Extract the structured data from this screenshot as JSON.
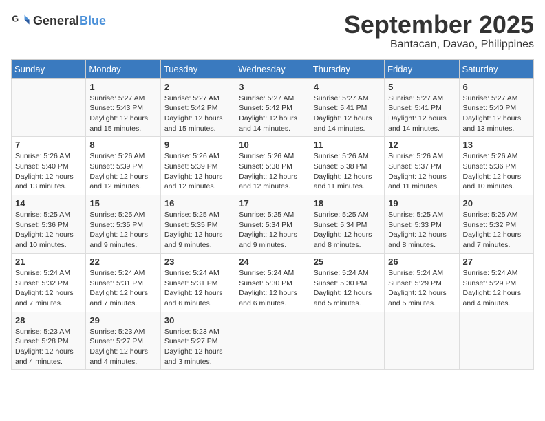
{
  "header": {
    "logo_general": "General",
    "logo_blue": "Blue",
    "month_title": "September 2025",
    "location": "Bantacan, Davao, Philippines"
  },
  "days_of_week": [
    "Sunday",
    "Monday",
    "Tuesday",
    "Wednesday",
    "Thursday",
    "Friday",
    "Saturday"
  ],
  "weeks": [
    [
      {
        "day": "",
        "info": ""
      },
      {
        "day": "1",
        "info": "Sunrise: 5:27 AM\nSunset: 5:43 PM\nDaylight: 12 hours\nand 15 minutes."
      },
      {
        "day": "2",
        "info": "Sunrise: 5:27 AM\nSunset: 5:42 PM\nDaylight: 12 hours\nand 15 minutes."
      },
      {
        "day": "3",
        "info": "Sunrise: 5:27 AM\nSunset: 5:42 PM\nDaylight: 12 hours\nand 14 minutes."
      },
      {
        "day": "4",
        "info": "Sunrise: 5:27 AM\nSunset: 5:41 PM\nDaylight: 12 hours\nand 14 minutes."
      },
      {
        "day": "5",
        "info": "Sunrise: 5:27 AM\nSunset: 5:41 PM\nDaylight: 12 hours\nand 14 minutes."
      },
      {
        "day": "6",
        "info": "Sunrise: 5:27 AM\nSunset: 5:40 PM\nDaylight: 12 hours\nand 13 minutes."
      }
    ],
    [
      {
        "day": "7",
        "info": "Sunrise: 5:26 AM\nSunset: 5:40 PM\nDaylight: 12 hours\nand 13 minutes."
      },
      {
        "day": "8",
        "info": "Sunrise: 5:26 AM\nSunset: 5:39 PM\nDaylight: 12 hours\nand 12 minutes."
      },
      {
        "day": "9",
        "info": "Sunrise: 5:26 AM\nSunset: 5:39 PM\nDaylight: 12 hours\nand 12 minutes."
      },
      {
        "day": "10",
        "info": "Sunrise: 5:26 AM\nSunset: 5:38 PM\nDaylight: 12 hours\nand 12 minutes."
      },
      {
        "day": "11",
        "info": "Sunrise: 5:26 AM\nSunset: 5:38 PM\nDaylight: 12 hours\nand 11 minutes."
      },
      {
        "day": "12",
        "info": "Sunrise: 5:26 AM\nSunset: 5:37 PM\nDaylight: 12 hours\nand 11 minutes."
      },
      {
        "day": "13",
        "info": "Sunrise: 5:26 AM\nSunset: 5:36 PM\nDaylight: 12 hours\nand 10 minutes."
      }
    ],
    [
      {
        "day": "14",
        "info": "Sunrise: 5:25 AM\nSunset: 5:36 PM\nDaylight: 12 hours\nand 10 minutes."
      },
      {
        "day": "15",
        "info": "Sunrise: 5:25 AM\nSunset: 5:35 PM\nDaylight: 12 hours\nand 9 minutes."
      },
      {
        "day": "16",
        "info": "Sunrise: 5:25 AM\nSunset: 5:35 PM\nDaylight: 12 hours\nand 9 minutes."
      },
      {
        "day": "17",
        "info": "Sunrise: 5:25 AM\nSunset: 5:34 PM\nDaylight: 12 hours\nand 9 minutes."
      },
      {
        "day": "18",
        "info": "Sunrise: 5:25 AM\nSunset: 5:34 PM\nDaylight: 12 hours\nand 8 minutes."
      },
      {
        "day": "19",
        "info": "Sunrise: 5:25 AM\nSunset: 5:33 PM\nDaylight: 12 hours\nand 8 minutes."
      },
      {
        "day": "20",
        "info": "Sunrise: 5:25 AM\nSunset: 5:32 PM\nDaylight: 12 hours\nand 7 minutes."
      }
    ],
    [
      {
        "day": "21",
        "info": "Sunrise: 5:24 AM\nSunset: 5:32 PM\nDaylight: 12 hours\nand 7 minutes."
      },
      {
        "day": "22",
        "info": "Sunrise: 5:24 AM\nSunset: 5:31 PM\nDaylight: 12 hours\nand 7 minutes."
      },
      {
        "day": "23",
        "info": "Sunrise: 5:24 AM\nSunset: 5:31 PM\nDaylight: 12 hours\nand 6 minutes."
      },
      {
        "day": "24",
        "info": "Sunrise: 5:24 AM\nSunset: 5:30 PM\nDaylight: 12 hours\nand 6 minutes."
      },
      {
        "day": "25",
        "info": "Sunrise: 5:24 AM\nSunset: 5:30 PM\nDaylight: 12 hours\nand 5 minutes."
      },
      {
        "day": "26",
        "info": "Sunrise: 5:24 AM\nSunset: 5:29 PM\nDaylight: 12 hours\nand 5 minutes."
      },
      {
        "day": "27",
        "info": "Sunrise: 5:24 AM\nSunset: 5:29 PM\nDaylight: 12 hours\nand 4 minutes."
      }
    ],
    [
      {
        "day": "28",
        "info": "Sunrise: 5:23 AM\nSunset: 5:28 PM\nDaylight: 12 hours\nand 4 minutes."
      },
      {
        "day": "29",
        "info": "Sunrise: 5:23 AM\nSunset: 5:27 PM\nDaylight: 12 hours\nand 4 minutes."
      },
      {
        "day": "30",
        "info": "Sunrise: 5:23 AM\nSunset: 5:27 PM\nDaylight: 12 hours\nand 3 minutes."
      },
      {
        "day": "",
        "info": ""
      },
      {
        "day": "",
        "info": ""
      },
      {
        "day": "",
        "info": ""
      },
      {
        "day": "",
        "info": ""
      }
    ]
  ]
}
